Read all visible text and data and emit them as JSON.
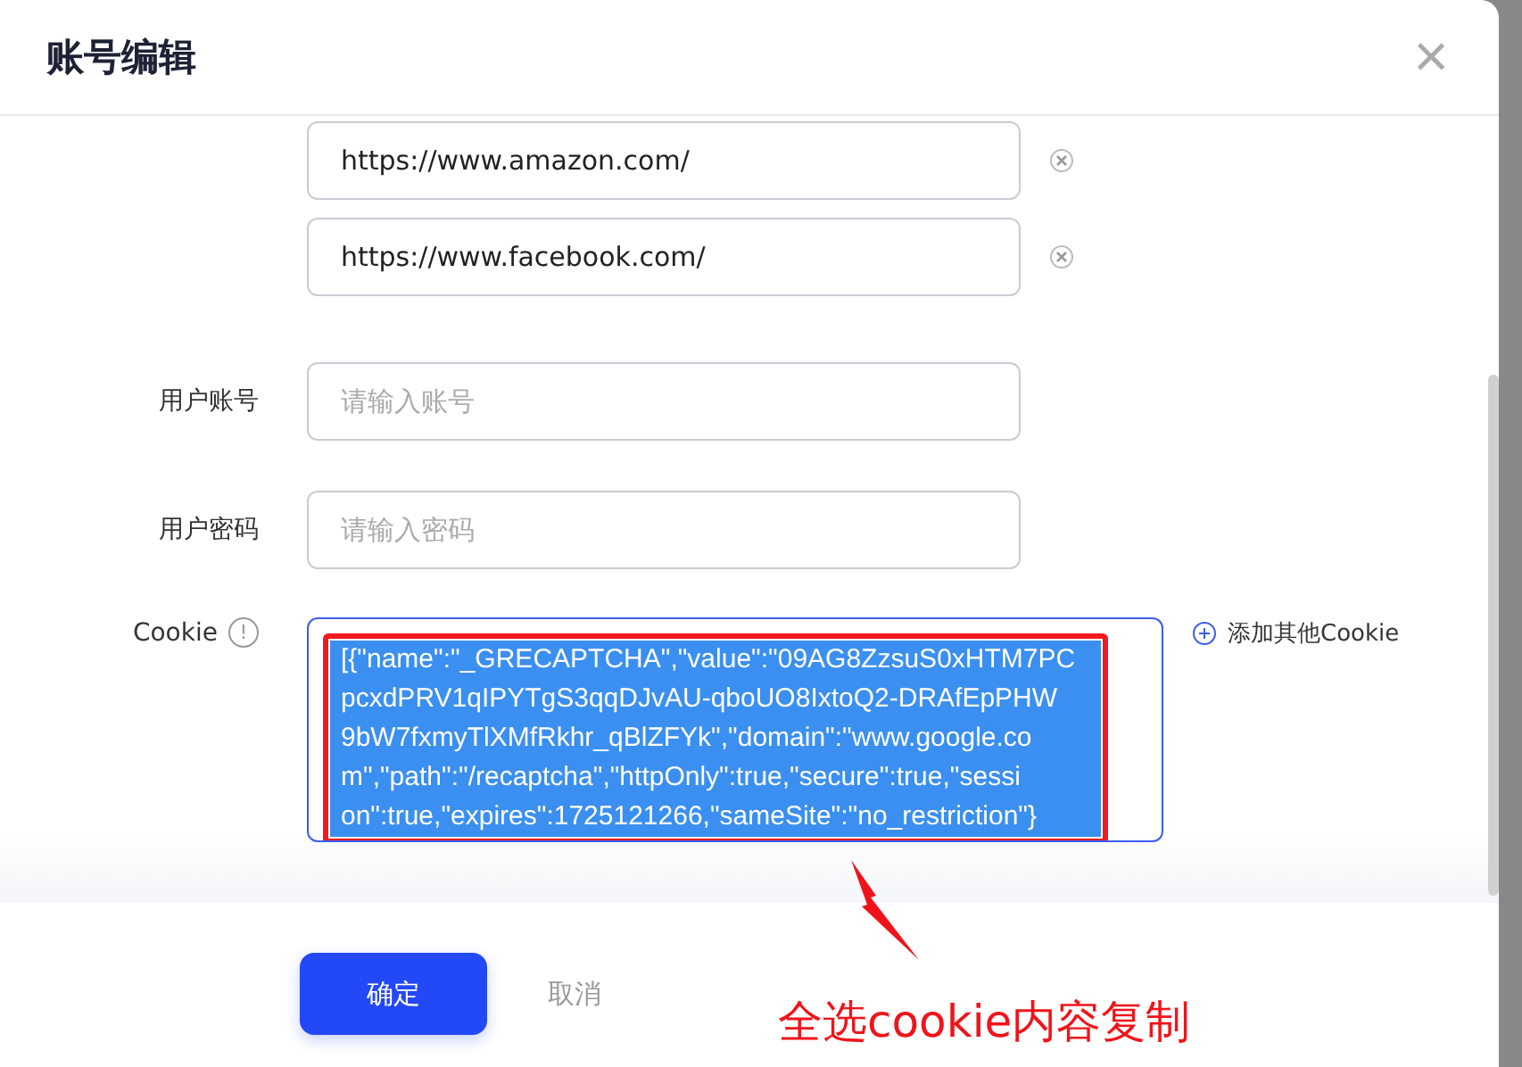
{
  "dialog": {
    "title": "账号编辑",
    "close": "×"
  },
  "urls": [
    {
      "value": "https://www.amazon.com/"
    },
    {
      "value": "https://www.facebook.com/"
    }
  ],
  "fields": [
    {
      "label": "用户账号",
      "placeholder": "请输入账号"
    },
    {
      "label": "用户密码",
      "placeholder": "请输入密码"
    }
  ],
  "cookie": {
    "label": "Cookie",
    "info": "!",
    "selected": true,
    "lines": [
      "[{\"name\":\"_GRECAPTCHA\",\"value\":\"09AG8ZzsuS0xHTM7PC",
      "pcxdPRV1qIPYTgS3qqDJvAU-qboUO8IxtoQ2-DRAfEpPHW",
      "9bW7fxmyTlXMfRkhr_qBlZFYk\",\"domain\":\"www.google.co",
      "m\",\"path\":\"/recaptcha\",\"httpOnly\":true,\"secure\":true,\"sessi",
      "on\":true,\"expires\":1725121266,\"sameSite\":\"no_restriction\"}"
    ],
    "add": "添加其他Cookie"
  },
  "buttons": [
    {
      "label": "确定",
      "kind": "primary"
    },
    {
      "label": "取消",
      "kind": "text"
    }
  ],
  "annotation": {
    "text": "全选cookie内容复制"
  }
}
